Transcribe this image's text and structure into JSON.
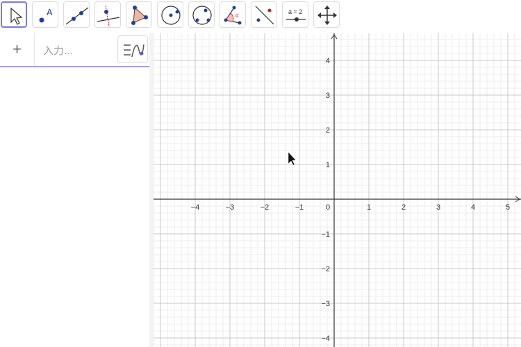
{
  "toolbar": {
    "tools": [
      {
        "name": "move-tool"
      },
      {
        "name": "point-tool",
        "label": "A"
      },
      {
        "name": "line-tool"
      },
      {
        "name": "perpendicular-line-tool"
      },
      {
        "name": "polygon-tool"
      },
      {
        "name": "circle-center-point-tool"
      },
      {
        "name": "circle-through-three-points-tool"
      },
      {
        "name": "angle-tool",
        "label": "α"
      },
      {
        "name": "reflect-about-line-tool"
      },
      {
        "name": "slider-tool",
        "label": "a = 2"
      },
      {
        "name": "move-graphics-view-tool"
      }
    ]
  },
  "algebra": {
    "add_label": "+",
    "input_placeholder": "入力..."
  },
  "graphics": {
    "x_ticks": [
      "−4",
      "−3",
      "−2",
      "−1",
      "0",
      "1",
      "2",
      "3",
      "4",
      "5"
    ],
    "y_ticks": [
      "4",
      "3",
      "2",
      "1",
      "−1",
      "−2",
      "−3",
      "−4"
    ]
  }
}
